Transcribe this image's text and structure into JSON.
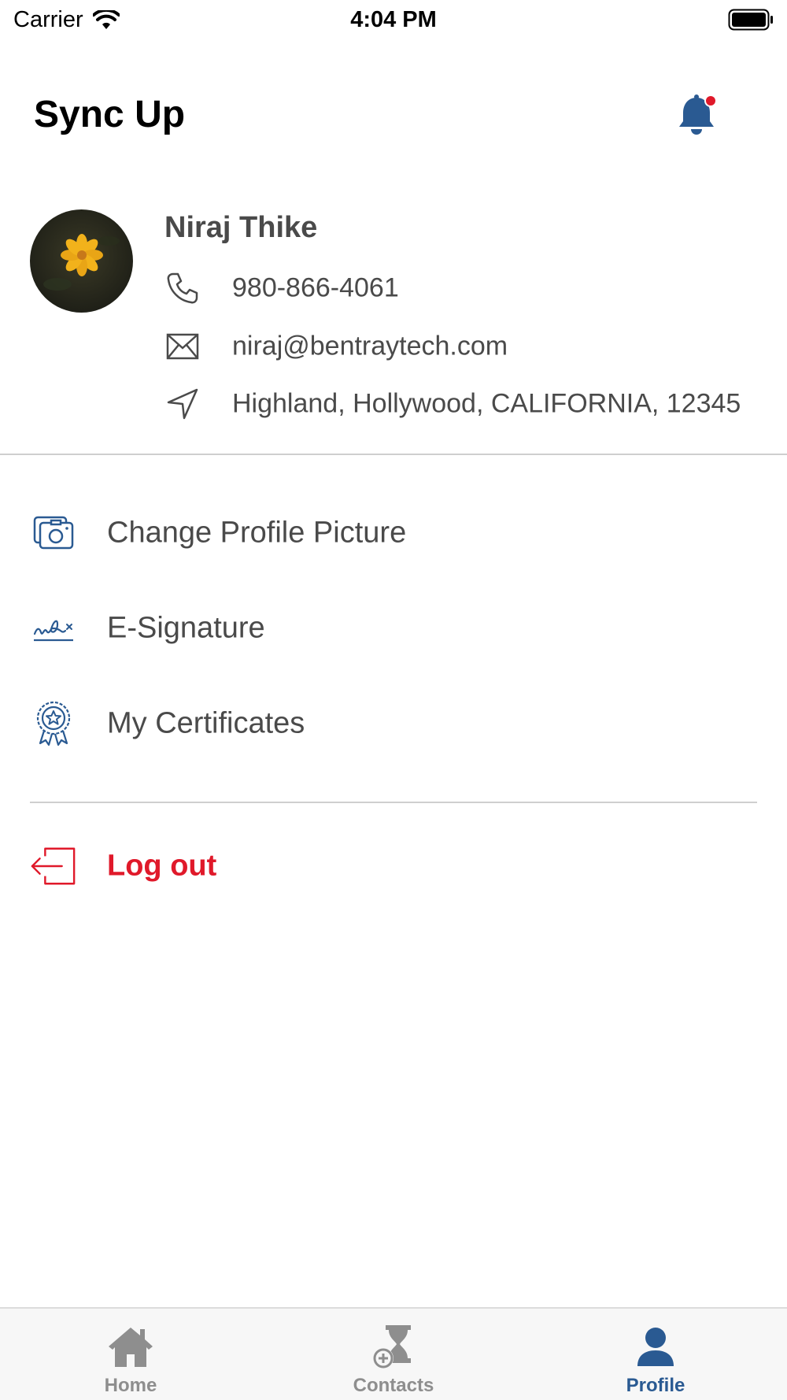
{
  "status_bar": {
    "carrier": "Carrier",
    "time": "4:04 PM"
  },
  "header": {
    "title": "Sync Up",
    "notification_icon": "bell-icon",
    "notification_dot_color": "#e0192a"
  },
  "profile": {
    "name": "Niraj Thike",
    "phone": "980-866-4061",
    "email": "niraj@bentraytech.com",
    "address": "Highland, Hollywood, CALIFORNIA, 12345"
  },
  "menu": {
    "items": [
      {
        "label": "Change Profile Picture",
        "icon": "camera-icon"
      },
      {
        "label": "E-Signature",
        "icon": "signature-icon"
      },
      {
        "label": "My Certificates",
        "icon": "certificate-badge-icon"
      }
    ],
    "logout_label": "Log out"
  },
  "tab_bar": {
    "tabs": [
      {
        "label": "Home",
        "icon": "home-icon",
        "active": false
      },
      {
        "label": "Contacts",
        "icon": "contacts-hourglass-icon",
        "active": false
      },
      {
        "label": "Profile",
        "icon": "person-icon",
        "active": true
      }
    ]
  },
  "colors": {
    "accent": "#2a5a92",
    "danger": "#e0192a",
    "inactive": "#8e8e8e"
  }
}
